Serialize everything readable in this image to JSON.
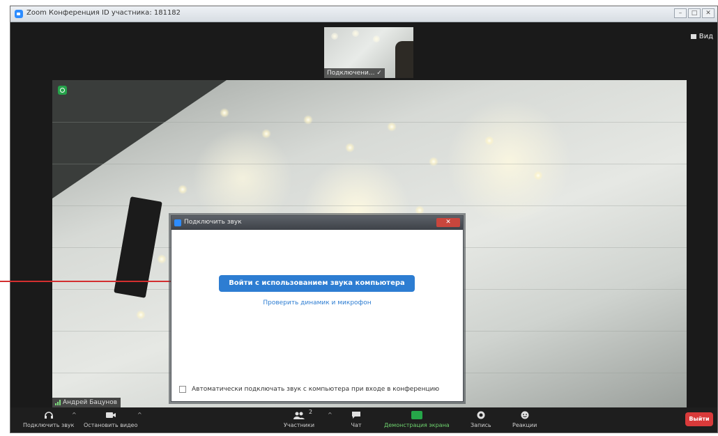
{
  "window": {
    "title": "Zoom Конференция ID участника: 181182"
  },
  "top_right": {
    "view_label": "Вид"
  },
  "thumbnail": {
    "label": "Подключени... ✓"
  },
  "main_video": {
    "participant_name": "Андрей Бацунов"
  },
  "dialog": {
    "title": "Подключить звук",
    "join_button": "Войти с использованием звука компьютера",
    "test_link": "Проверить динамик и микрофон",
    "auto_join_checkbox_label": "Автоматически подключать звук с компьютера при входе в конференцию",
    "auto_join_checked": false
  },
  "toolbar": {
    "join_audio": "Подключить звук",
    "stop_video": "Остановить видео",
    "participants": "Участники",
    "participants_count": "2",
    "chat": "Чат",
    "share_screen": "Демонстрация экрана",
    "record": "Запись",
    "reactions": "Реакции",
    "leave": "Выйти"
  },
  "colors": {
    "accent": "#2d7dd2",
    "leave": "#d93a3a",
    "share": "#26a649",
    "arrow": "#d32f2f"
  }
}
